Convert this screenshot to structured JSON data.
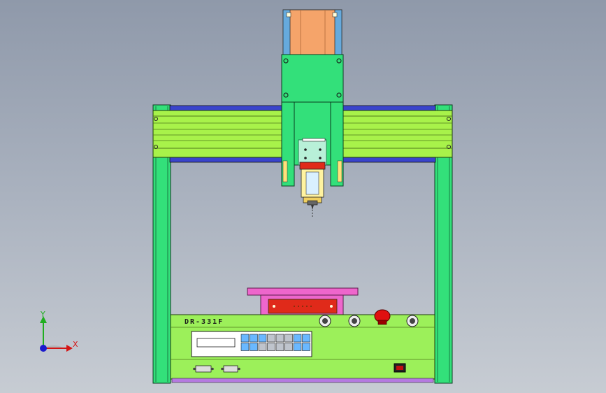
{
  "machine": {
    "model_label": "DR-331F"
  },
  "triad": {
    "x_label": "X",
    "y_label": "Y",
    "colors": {
      "x": "#d41414",
      "y": "#1fae1f",
      "z": "#1a1acc"
    }
  },
  "colors": {
    "background_top": "#8f99aa",
    "background_bottom": "#c7ccd3",
    "frame_green": "#33e07a",
    "body_lime": "#9cf05a",
    "panel_pink": "#ee66cc",
    "motor_orange": "#f5a46a",
    "stop_red": "#e01010",
    "key_blue": "#6ab8ff",
    "key_gray": "#bfc4cc"
  },
  "keypad": {
    "keys": [
      "blue",
      "blue",
      "blue",
      "gray",
      "gray",
      "gray",
      "blue",
      "blue",
      "blue",
      "blue",
      "gray",
      "gray",
      "gray",
      "gray",
      "blue",
      "blue"
    ]
  },
  "icons": [
    "estop-button",
    "selector-switch",
    "coordinate-triad",
    "power-switch",
    "db-connector",
    "nozzle"
  ]
}
